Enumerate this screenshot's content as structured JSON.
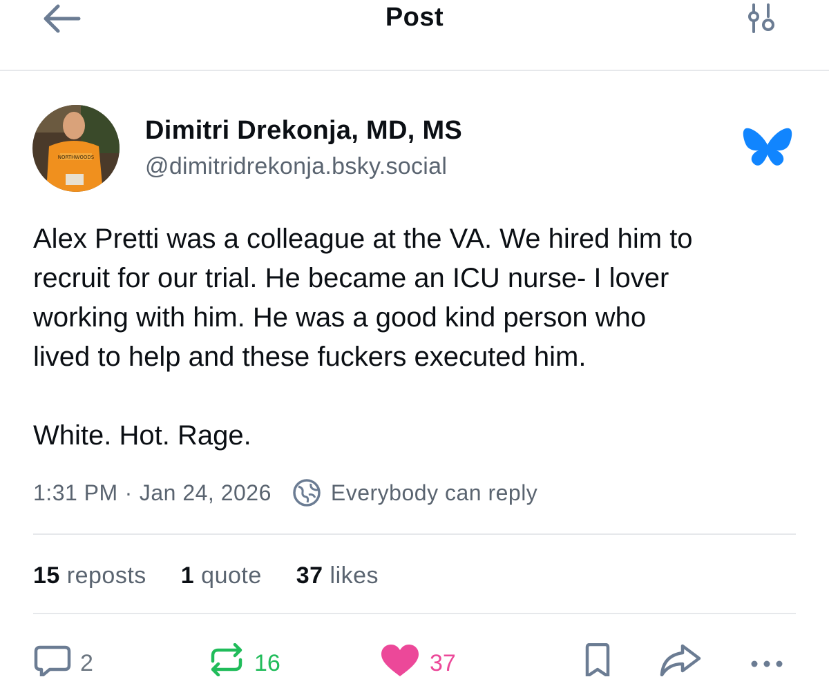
{
  "header": {
    "title": "Post",
    "back_icon": "arrow-left-icon",
    "settings_icon": "sliders-icon"
  },
  "author": {
    "display_name": "Dimitri Drekonja, MD, MS",
    "handle": "@dimitridrekonja.bsky.social",
    "badge_icon": "bluesky-butterfly-icon",
    "avatar_shirt_text": "NORTHWOODS"
  },
  "post": {
    "paragraphs": [
      "Alex Pretti was a colleague at the VA. We hired him to\nrecruit for our trial. He became an ICU nurse- I lover\nworking with him. He was a good kind person who\nlived to help and these fuckers executed him.",
      "White. Hot. Rage."
    ],
    "time": "1:31 PM",
    "separator": "·",
    "date": "Jan 24, 2026",
    "reply_setting": "Everybody can reply"
  },
  "stats": {
    "reposts": {
      "count": "15",
      "label": "reposts"
    },
    "quotes": {
      "count": "1",
      "label": "quote"
    },
    "likes": {
      "count": "37",
      "label": "likes"
    }
  },
  "actions": {
    "reply_count": "2",
    "repost_count": "16",
    "like_count": "37"
  },
  "colors": {
    "text": "#0b0f14",
    "muted": "#5a6470",
    "divider": "#e6e8eb",
    "bluesky_blue": "#1185fe",
    "repost_green": "#20bc5a",
    "like_pink": "#ec4899"
  }
}
